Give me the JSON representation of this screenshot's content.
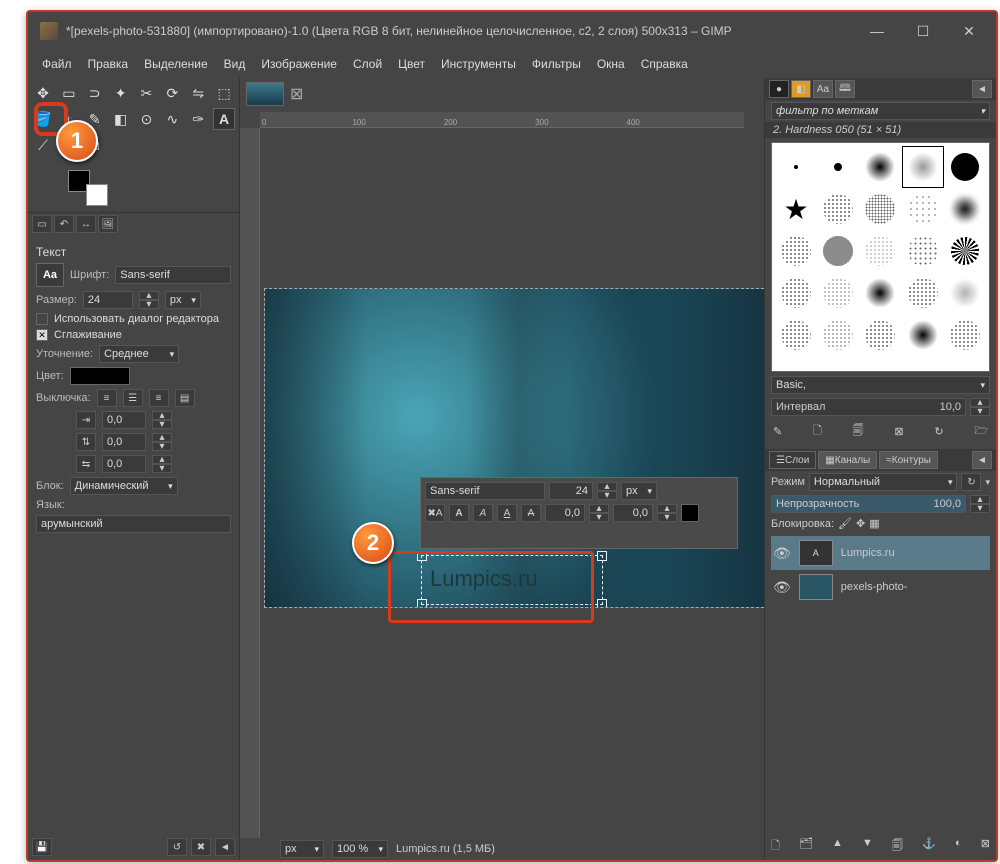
{
  "window": {
    "title": "*[pexels-photo-531880] (импортировано)-1.0 (Цвета RGB 8 бит, нелинейное целочисленное, c2, 2 слоя) 500x313 – GIMP"
  },
  "menu": {
    "file": "Файл",
    "edit": "Правка",
    "select": "Выделение",
    "view": "Вид",
    "image": "Изображение",
    "layer": "Слой",
    "color": "Цвет",
    "tools": "Инструменты",
    "filters": "Фильтры",
    "windows": "Окна",
    "help": "Справка"
  },
  "toolbox": {
    "section_title": "Текст",
    "font_label": "Шрифт:",
    "font_value": "Sans-serif",
    "font_icon": "Aa",
    "size_label": "Размер:",
    "size_value": "24",
    "size_unit": "px",
    "use_editor": "Использовать диалог редактора",
    "antialias": "Сглаживание",
    "hinting_label": "Уточнение:",
    "hinting_value": "Среднее",
    "color_label": "Цвет:",
    "justify_label": "Выключка:",
    "indent_value": "0,0",
    "line_value": "0,0",
    "letter_value": "0,0",
    "block_label": "Блок:",
    "block_value": "Динамический",
    "lang_label": "Язык:",
    "lang_value": "арумынский"
  },
  "canvas": {
    "text_content": "Lumpics.ru",
    "toolbar": {
      "font": "Sans-serif",
      "size": "24",
      "unit": "px",
      "spacing1": "0,0",
      "spacing2": "0,0"
    }
  },
  "status": {
    "unit": "px",
    "zoom": "100 %",
    "info": "Lumpics.ru (1,5 МБ)"
  },
  "ruler": {
    "m0": "0",
    "m100": "100",
    "m200": "200",
    "m300": "300",
    "m400": "400"
  },
  "right": {
    "filter_placeholder": "фильтр по меткам",
    "brush_info": "2. Hardness 050 (51 × 51)",
    "basic": "Basic,",
    "interval_label": "Интервал",
    "interval_value": "10,0",
    "tabs": {
      "layers": "Слои",
      "channels": "Каналы",
      "paths": "Контуры"
    },
    "mode_label": "Режим",
    "mode_value": "Нормальный",
    "opacity_label": "Непрозрачность",
    "opacity_value": "100,0",
    "lock_label": "Блокировка:",
    "layer1": "Lumpics.ru",
    "layer2": "pexels-photo-"
  },
  "callouts": {
    "one": "1",
    "two": "2"
  }
}
